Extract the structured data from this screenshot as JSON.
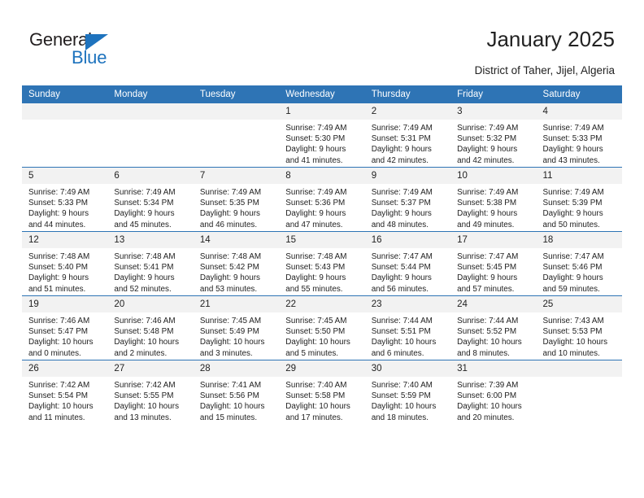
{
  "brand": {
    "name_part1": "General",
    "name_part2": "Blue",
    "accent_color": "#1e73be"
  },
  "header": {
    "title": "January 2025",
    "subtitle": "District of Taher, Jijel, Algeria"
  },
  "calendar": {
    "header_color": "#2e74b5",
    "daynum_band_color": "#f2f2f2",
    "weekday_headers": [
      "Sunday",
      "Monday",
      "Tuesday",
      "Wednesday",
      "Thursday",
      "Friday",
      "Saturday"
    ],
    "weeks": [
      [
        {
          "day": "",
          "empty": true,
          "sunrise": "",
          "sunset": "",
          "daylight_line1": "",
          "daylight_line2": ""
        },
        {
          "day": "",
          "empty": true,
          "sunrise": "",
          "sunset": "",
          "daylight_line1": "",
          "daylight_line2": ""
        },
        {
          "day": "",
          "empty": true,
          "sunrise": "",
          "sunset": "",
          "daylight_line1": "",
          "daylight_line2": ""
        },
        {
          "day": "1",
          "empty": false,
          "sunrise": "Sunrise: 7:49 AM",
          "sunset": "Sunset: 5:30 PM",
          "daylight_line1": "Daylight: 9 hours",
          "daylight_line2": "and 41 minutes."
        },
        {
          "day": "2",
          "empty": false,
          "sunrise": "Sunrise: 7:49 AM",
          "sunset": "Sunset: 5:31 PM",
          "daylight_line1": "Daylight: 9 hours",
          "daylight_line2": "and 42 minutes."
        },
        {
          "day": "3",
          "empty": false,
          "sunrise": "Sunrise: 7:49 AM",
          "sunset": "Sunset: 5:32 PM",
          "daylight_line1": "Daylight: 9 hours",
          "daylight_line2": "and 42 minutes."
        },
        {
          "day": "4",
          "empty": false,
          "sunrise": "Sunrise: 7:49 AM",
          "sunset": "Sunset: 5:33 PM",
          "daylight_line1": "Daylight: 9 hours",
          "daylight_line2": "and 43 minutes."
        }
      ],
      [
        {
          "day": "5",
          "empty": false,
          "sunrise": "Sunrise: 7:49 AM",
          "sunset": "Sunset: 5:33 PM",
          "daylight_line1": "Daylight: 9 hours",
          "daylight_line2": "and 44 minutes."
        },
        {
          "day": "6",
          "empty": false,
          "sunrise": "Sunrise: 7:49 AM",
          "sunset": "Sunset: 5:34 PM",
          "daylight_line1": "Daylight: 9 hours",
          "daylight_line2": "and 45 minutes."
        },
        {
          "day": "7",
          "empty": false,
          "sunrise": "Sunrise: 7:49 AM",
          "sunset": "Sunset: 5:35 PM",
          "daylight_line1": "Daylight: 9 hours",
          "daylight_line2": "and 46 minutes."
        },
        {
          "day": "8",
          "empty": false,
          "sunrise": "Sunrise: 7:49 AM",
          "sunset": "Sunset: 5:36 PM",
          "daylight_line1": "Daylight: 9 hours",
          "daylight_line2": "and 47 minutes."
        },
        {
          "day": "9",
          "empty": false,
          "sunrise": "Sunrise: 7:49 AM",
          "sunset": "Sunset: 5:37 PM",
          "daylight_line1": "Daylight: 9 hours",
          "daylight_line2": "and 48 minutes."
        },
        {
          "day": "10",
          "empty": false,
          "sunrise": "Sunrise: 7:49 AM",
          "sunset": "Sunset: 5:38 PM",
          "daylight_line1": "Daylight: 9 hours",
          "daylight_line2": "and 49 minutes."
        },
        {
          "day": "11",
          "empty": false,
          "sunrise": "Sunrise: 7:49 AM",
          "sunset": "Sunset: 5:39 PM",
          "daylight_line1": "Daylight: 9 hours",
          "daylight_line2": "and 50 minutes."
        }
      ],
      [
        {
          "day": "12",
          "empty": false,
          "sunrise": "Sunrise: 7:48 AM",
          "sunset": "Sunset: 5:40 PM",
          "daylight_line1": "Daylight: 9 hours",
          "daylight_line2": "and 51 minutes."
        },
        {
          "day": "13",
          "empty": false,
          "sunrise": "Sunrise: 7:48 AM",
          "sunset": "Sunset: 5:41 PM",
          "daylight_line1": "Daylight: 9 hours",
          "daylight_line2": "and 52 minutes."
        },
        {
          "day": "14",
          "empty": false,
          "sunrise": "Sunrise: 7:48 AM",
          "sunset": "Sunset: 5:42 PM",
          "daylight_line1": "Daylight: 9 hours",
          "daylight_line2": "and 53 minutes."
        },
        {
          "day": "15",
          "empty": false,
          "sunrise": "Sunrise: 7:48 AM",
          "sunset": "Sunset: 5:43 PM",
          "daylight_line1": "Daylight: 9 hours",
          "daylight_line2": "and 55 minutes."
        },
        {
          "day": "16",
          "empty": false,
          "sunrise": "Sunrise: 7:47 AM",
          "sunset": "Sunset: 5:44 PM",
          "daylight_line1": "Daylight: 9 hours",
          "daylight_line2": "and 56 minutes."
        },
        {
          "day": "17",
          "empty": false,
          "sunrise": "Sunrise: 7:47 AM",
          "sunset": "Sunset: 5:45 PM",
          "daylight_line1": "Daylight: 9 hours",
          "daylight_line2": "and 57 minutes."
        },
        {
          "day": "18",
          "empty": false,
          "sunrise": "Sunrise: 7:47 AM",
          "sunset": "Sunset: 5:46 PM",
          "daylight_line1": "Daylight: 9 hours",
          "daylight_line2": "and 59 minutes."
        }
      ],
      [
        {
          "day": "19",
          "empty": false,
          "sunrise": "Sunrise: 7:46 AM",
          "sunset": "Sunset: 5:47 PM",
          "daylight_line1": "Daylight: 10 hours",
          "daylight_line2": "and 0 minutes."
        },
        {
          "day": "20",
          "empty": false,
          "sunrise": "Sunrise: 7:46 AM",
          "sunset": "Sunset: 5:48 PM",
          "daylight_line1": "Daylight: 10 hours",
          "daylight_line2": "and 2 minutes."
        },
        {
          "day": "21",
          "empty": false,
          "sunrise": "Sunrise: 7:45 AM",
          "sunset": "Sunset: 5:49 PM",
          "daylight_line1": "Daylight: 10 hours",
          "daylight_line2": "and 3 minutes."
        },
        {
          "day": "22",
          "empty": false,
          "sunrise": "Sunrise: 7:45 AM",
          "sunset": "Sunset: 5:50 PM",
          "daylight_line1": "Daylight: 10 hours",
          "daylight_line2": "and 5 minutes."
        },
        {
          "day": "23",
          "empty": false,
          "sunrise": "Sunrise: 7:44 AM",
          "sunset": "Sunset: 5:51 PM",
          "daylight_line1": "Daylight: 10 hours",
          "daylight_line2": "and 6 minutes."
        },
        {
          "day": "24",
          "empty": false,
          "sunrise": "Sunrise: 7:44 AM",
          "sunset": "Sunset: 5:52 PM",
          "daylight_line1": "Daylight: 10 hours",
          "daylight_line2": "and 8 minutes."
        },
        {
          "day": "25",
          "empty": false,
          "sunrise": "Sunrise: 7:43 AM",
          "sunset": "Sunset: 5:53 PM",
          "daylight_line1": "Daylight: 10 hours",
          "daylight_line2": "and 10 minutes."
        }
      ],
      [
        {
          "day": "26",
          "empty": false,
          "sunrise": "Sunrise: 7:42 AM",
          "sunset": "Sunset: 5:54 PM",
          "daylight_line1": "Daylight: 10 hours",
          "daylight_line2": "and 11 minutes."
        },
        {
          "day": "27",
          "empty": false,
          "sunrise": "Sunrise: 7:42 AM",
          "sunset": "Sunset: 5:55 PM",
          "daylight_line1": "Daylight: 10 hours",
          "daylight_line2": "and 13 minutes."
        },
        {
          "day": "28",
          "empty": false,
          "sunrise": "Sunrise: 7:41 AM",
          "sunset": "Sunset: 5:56 PM",
          "daylight_line1": "Daylight: 10 hours",
          "daylight_line2": "and 15 minutes."
        },
        {
          "day": "29",
          "empty": false,
          "sunrise": "Sunrise: 7:40 AM",
          "sunset": "Sunset: 5:58 PM",
          "daylight_line1": "Daylight: 10 hours",
          "daylight_line2": "and 17 minutes."
        },
        {
          "day": "30",
          "empty": false,
          "sunrise": "Sunrise: 7:40 AM",
          "sunset": "Sunset: 5:59 PM",
          "daylight_line1": "Daylight: 10 hours",
          "daylight_line2": "and 18 minutes."
        },
        {
          "day": "31",
          "empty": false,
          "sunrise": "Sunrise: 7:39 AM",
          "sunset": "Sunset: 6:00 PM",
          "daylight_line1": "Daylight: 10 hours",
          "daylight_line2": "and 20 minutes."
        },
        {
          "day": "",
          "empty": true,
          "sunrise": "",
          "sunset": "",
          "daylight_line1": "",
          "daylight_line2": ""
        }
      ]
    ]
  }
}
